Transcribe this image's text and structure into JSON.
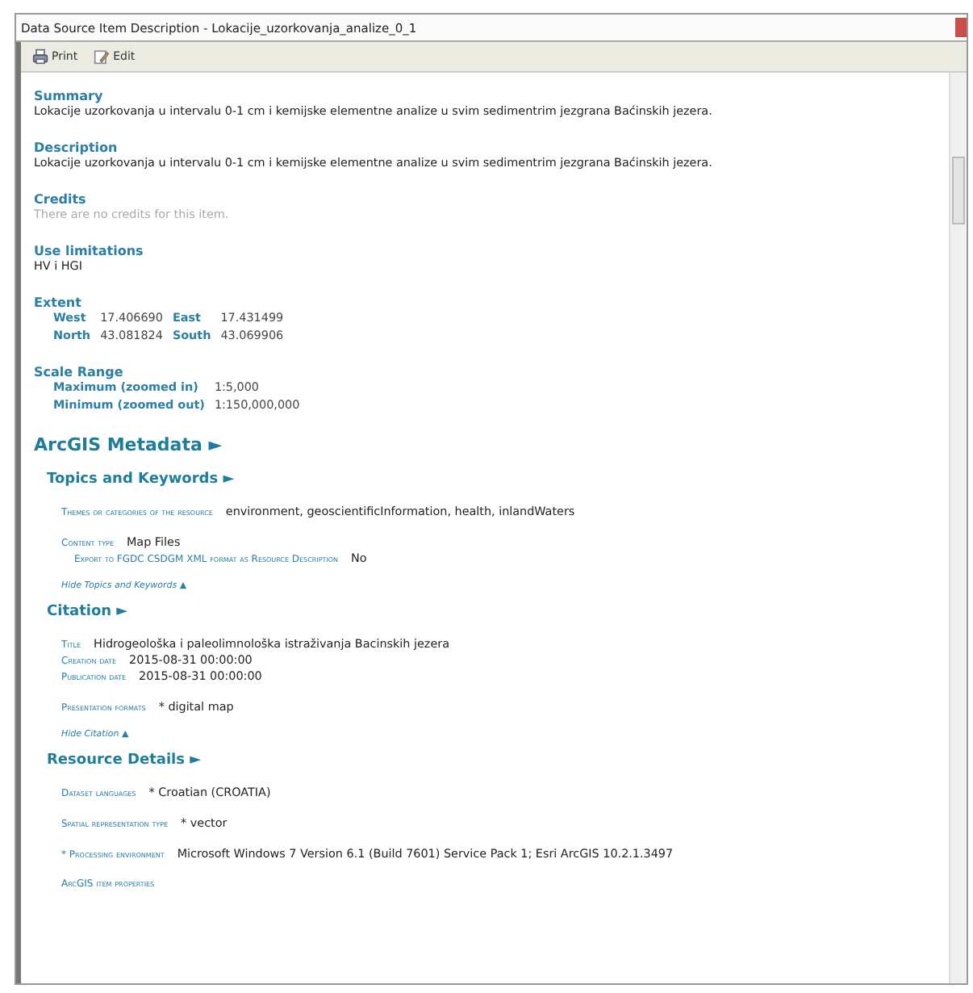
{
  "window": {
    "title": "Data Source Item Description - Lokacije_uzorkovanja_analize_0_1"
  },
  "toolbar": [
    {
      "label": "Print",
      "kind": "print"
    },
    {
      "label": "Edit",
      "kind": "edit"
    }
  ],
  "summary": {
    "heading": "Summary",
    "text": "Lokacije uzorkovanja u intervalu 0-1 cm i kemijske elementne analize u svim sedimentrim jezgrana Baćinskih jezera."
  },
  "description": {
    "heading": "Description",
    "text": "Lokacije uzorkovanja u intervalu 0-1 cm i kemijske elementne analize u svim sedimentrim jezgrana Baćinskih jezera."
  },
  "credits": {
    "heading": "Credits",
    "text": "There are no credits for this item."
  },
  "use_limitations": {
    "heading": "Use limitations",
    "text": "HV i HGI"
  },
  "extent": {
    "heading": "Extent",
    "items": [
      {
        "label": "West",
        "value": "17.406690"
      },
      {
        "label": "East",
        "value": "17.431499"
      },
      {
        "label": "North",
        "value": "43.081824"
      },
      {
        "label": "South",
        "value": "43.069906"
      }
    ]
  },
  "scale_range": {
    "heading": "Scale Range",
    "rows": [
      {
        "label": "Maximum (zoomed in)",
        "value": "1:5,000"
      },
      {
        "label": "Minimum (zoomed out)",
        "value": "1:150,000,000"
      }
    ]
  },
  "metadata": {
    "heading": "ArcGIS Metadata ►",
    "sections": [
      {
        "heading": "Topics and Keywords ►",
        "groups": [
          [
            {
              "label": "Themes or categories of the resource",
              "value": "environment, geoscientificInformation, health, inlandWaters",
              "kind": "row"
            }
          ],
          [
            {
              "label": "Content type",
              "value": "Map Files",
              "kind": "row"
            },
            {
              "label": "Export to FGDC CSDGM XML format as Resource Description",
              "value": "No",
              "kind": "sub"
            }
          ]
        ],
        "hide_link": "Hide Topics and Keywords ▲"
      },
      {
        "heading": "Citation ►",
        "groups": [
          [
            {
              "label": "Title",
              "value": "Hidrogeološka i paleolimnološka istraživanja Bacinskih jezera",
              "kind": "row"
            },
            {
              "label": "Creation date",
              "value": "2015-08-31  00:00:00",
              "kind": "row"
            },
            {
              "label": "Publication date",
              "value": "2015-08-31  00:00:00",
              "kind": "row"
            }
          ],
          [
            {
              "label": "Presentation formats",
              "value": "* digital map",
              "kind": "row"
            }
          ]
        ],
        "hide_link": "Hide Citation ▲"
      },
      {
        "heading": "Resource Details ►",
        "groups": [
          [
            {
              "label": "Dataset languages",
              "value": "* Croatian (CROATIA)",
              "kind": "row"
            }
          ],
          [
            {
              "label": "Spatial representation type",
              "value": "* vector",
              "kind": "row"
            }
          ],
          [
            {
              "label": "* Processing environment",
              "value": "Microsoft Windows 7 Version 6.1 (Build 7601) Service Pack 1; Esri ArcGIS 10.2.1.3497",
              "kind": "row"
            }
          ],
          [
            {
              "label": "ArcGIS item properties",
              "kind": "row"
            }
          ]
        ]
      }
    ]
  }
}
